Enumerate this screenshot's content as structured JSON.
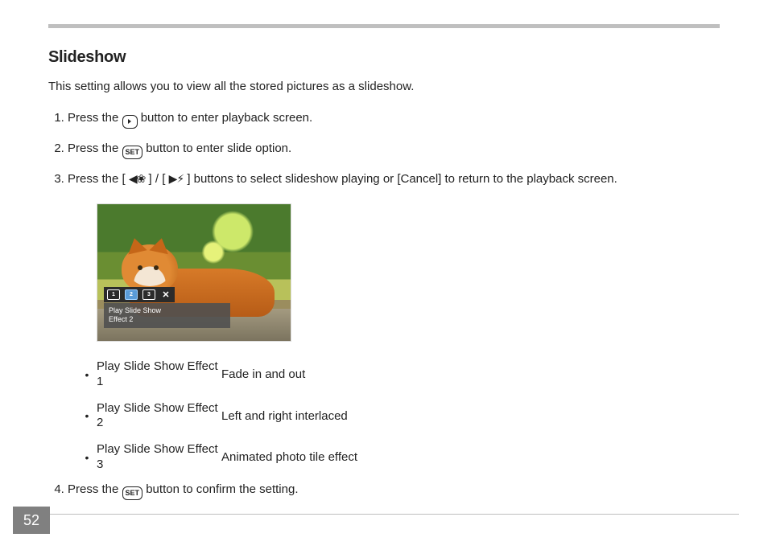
{
  "heading": "Slideshow",
  "intro": "This setting allows you to view all the stored pictures as a slideshow.",
  "steps": {
    "s1_pre": "Press the ",
    "s1_post": " button to enter playback screen.",
    "s2_pre": "Press the ",
    "s2_post": " button to enter slide option.",
    "s3_pre": "Press the [ ",
    "s3_mid": " ] / [ ",
    "s3_post": " ] buttons to select slideshow playing or [Cancel] to return to the playback screen.",
    "s4_pre": "Press the ",
    "s4_post": " button to confirm the setting."
  },
  "icons": {
    "playback_label": "▶",
    "set_label": "SET",
    "left_arrows": "◀❀",
    "right_arrows": "▶⚡"
  },
  "photo": {
    "toolbar_items": [
      "1",
      "2",
      "3"
    ],
    "toolbar_close": "✕",
    "caption_line1": "Play Slide Show",
    "caption_line2": "Effect 2"
  },
  "effects": [
    {
      "label": "Play Slide Show Effect 1",
      "desc": "Fade in and out"
    },
    {
      "label": "Play Slide Show Effect 2",
      "desc": "Left and right interlaced"
    },
    {
      "label": "Play Slide Show Effect 3",
      "desc": "Animated photo tile effect"
    }
  ],
  "page_number": "52"
}
